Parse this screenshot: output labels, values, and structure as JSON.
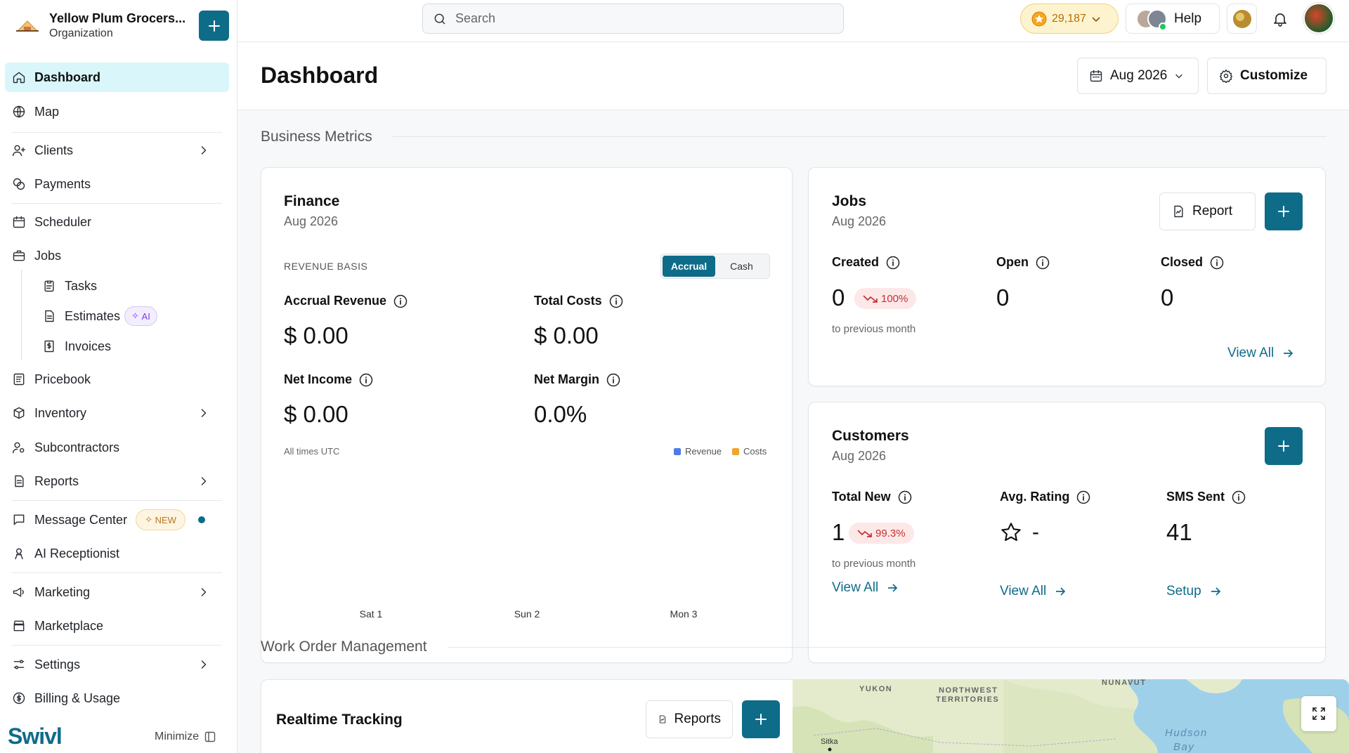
{
  "org": {
    "name": "Yellow Plum Grocers...",
    "type": "Organization"
  },
  "sidebar": {
    "items": [
      {
        "label": "Dashboard"
      },
      {
        "label": "Map"
      },
      {
        "label": "Clients"
      },
      {
        "label": "Payments"
      },
      {
        "label": "Scheduler"
      },
      {
        "label": "Jobs"
      },
      {
        "label": "Tasks"
      },
      {
        "label": "Estimates",
        "badge": "AI"
      },
      {
        "label": "Invoices"
      },
      {
        "label": "Pricebook"
      },
      {
        "label": "Inventory"
      },
      {
        "label": "Subcontractors"
      },
      {
        "label": "Reports"
      },
      {
        "label": "Message Center",
        "badge": "NEW"
      },
      {
        "label": "AI Receptionist"
      },
      {
        "label": "Marketing"
      },
      {
        "label": "Marketplace"
      },
      {
        "label": "Settings"
      },
      {
        "label": "Billing & Usage"
      }
    ],
    "brand": "Swivl",
    "minimize": "Minimize"
  },
  "topbar": {
    "search_placeholder": "Search",
    "coins": "29,187",
    "help": "Help"
  },
  "header": {
    "title": "Dashboard",
    "month": "Aug 2026",
    "customize": "Customize"
  },
  "sections": {
    "business": "Business Metrics",
    "work_orders": "Work Order Management"
  },
  "finance": {
    "title": "Finance",
    "period": "Aug 2026",
    "basis_label": "REVENUE BASIS",
    "toggle": [
      "Accrual",
      "Cash"
    ],
    "accrual_revenue_label": "Accrual Revenue",
    "accrual_revenue": "$ 0.00",
    "total_costs_label": "Total Costs",
    "total_costs": "$ 0.00",
    "net_income_label": "Net Income",
    "net_income": "$ 0.00",
    "net_margin_label": "Net Margin",
    "net_margin": "0.0%",
    "tz": "All times UTC"
  },
  "chart_data": {
    "type": "bar",
    "categories": [
      "Sat 1",
      "Sun 2",
      "Mon 3"
    ],
    "series": [
      {
        "name": "Revenue",
        "values": [
          0,
          0,
          0
        ],
        "color": "#4f7be8"
      },
      {
        "name": "Costs",
        "values": [
          0,
          0,
          0
        ],
        "color": "#f0a52c"
      }
    ],
    "title": "",
    "xlabel": "",
    "ylabel": "",
    "legend": "top-right"
  },
  "jobs": {
    "title": "Jobs",
    "period": "Aug 2026",
    "report": "Report",
    "created_label": "Created",
    "created": "0",
    "created_change": "100%",
    "open_label": "Open",
    "open": "0",
    "closed_label": "Closed",
    "closed": "0",
    "compare": "to previous month",
    "view_all": "View All"
  },
  "customers": {
    "title": "Customers",
    "period": "Aug 2026",
    "total_new_label": "Total New",
    "total_new": "1",
    "total_new_change": "99.3%",
    "rating_label": "Avg. Rating",
    "rating": "-",
    "sms_label": "SMS Sent",
    "sms": "41",
    "compare": "to previous month",
    "view_all": "View All",
    "view_all_2": "View All",
    "setup": "Setup"
  },
  "tracking": {
    "title": "Realtime Tracking",
    "reports": "Reports",
    "map_labels": [
      "YUKON",
      "NORTHWEST",
      "TERRITORIES",
      "NUNAVUT",
      "Hudson",
      "Bay",
      "Sitka"
    ]
  },
  "colors": {
    "accent": "#0e6c89",
    "active_bg": "#d9f6fb",
    "down": "#c53030"
  }
}
